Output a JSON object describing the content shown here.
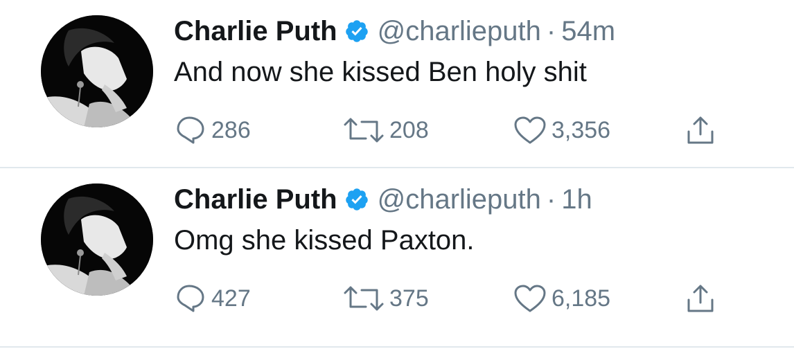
{
  "tweets": [
    {
      "author_name": "Charlie Puth",
      "handle": "@charlieputh",
      "separator": "·",
      "time": "54m",
      "text": "And now she kissed Ben holy shit",
      "replies": "286",
      "retweets": "208",
      "likes": "3,356",
      "icons": [
        "verified-badge-icon",
        "reply-icon",
        "retweet-icon",
        "like-icon",
        "share-icon"
      ]
    },
    {
      "author_name": "Charlie Puth",
      "handle": "@charlieputh",
      "separator": "·",
      "time": "1h",
      "text": "Omg she kissed Paxton.",
      "replies": "427",
      "retweets": "375",
      "likes": "6,185",
      "icons": [
        "verified-badge-icon",
        "reply-icon",
        "retweet-icon",
        "like-icon",
        "share-icon"
      ]
    }
  ],
  "colors": {
    "text_primary": "#14171a",
    "text_secondary": "#657786",
    "verified_blue": "#1da1f2",
    "divider": "#e1e8ed",
    "background": "#ffffff"
  }
}
